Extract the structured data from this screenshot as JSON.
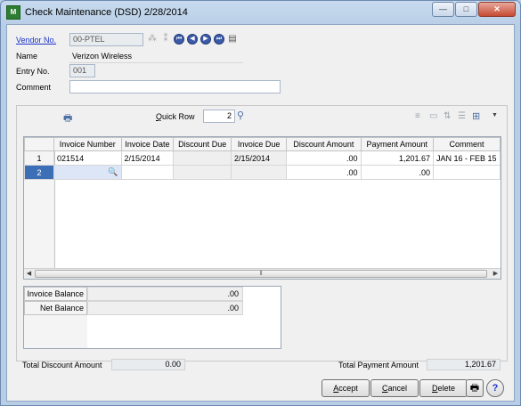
{
  "window": {
    "title": "Check Maintenance (DSD) 2/28/2014",
    "app_icon": "sage-green-icon",
    "min": "—",
    "max": "□",
    "close": "✕"
  },
  "header": {
    "vendor_label": "Vendor No.",
    "vendor_value": "00-PTEL",
    "name_label": "Name",
    "name_value": "Verizon Wireless",
    "entry_label": "Entry No.",
    "entry_value": "001",
    "comment_label": "Comment",
    "comment_value": ""
  },
  "toolbar": {
    "quick_row_label": "Quick Row",
    "quick_row_value": "2"
  },
  "grid": {
    "columns": [
      "Invoice Number",
      "Invoice Date",
      "Discount Due",
      "Invoice Due",
      "Discount Amount",
      "Payment Amount",
      "Comment"
    ],
    "rows": [
      {
        "n": "1",
        "invoice": "021514",
        "inv_date": "2/15/2014",
        "disc_due": "",
        "inv_due": "2/15/2014",
        "disc_amt": ".00",
        "pay_amt": "1,201.67",
        "comment": "JAN 16 - FEB 15"
      },
      {
        "n": "2",
        "invoice": "",
        "inv_date": "",
        "disc_due": "",
        "inv_due": "",
        "disc_amt": ".00",
        "pay_amt": ".00",
        "comment": ""
      }
    ]
  },
  "balance": {
    "invoice_balance_label": "Invoice Balance",
    "invoice_balance_value": ".00",
    "net_balance_label": "Net Balance",
    "net_balance_value": ".00"
  },
  "totals": {
    "discount_label": "Total Discount Amount",
    "discount_value": "0.00",
    "payment_label": "Total Payment Amount",
    "payment_value": "1,201.67"
  },
  "buttons": {
    "accept_u": "A",
    "accept_rest": "ccept",
    "cancel_u": "C",
    "cancel_rest": "ancel",
    "delete_u": "D",
    "delete_rest": "elete"
  },
  "colors": {
    "accent": "#3d6fb6",
    "link": "#1a33c9"
  }
}
